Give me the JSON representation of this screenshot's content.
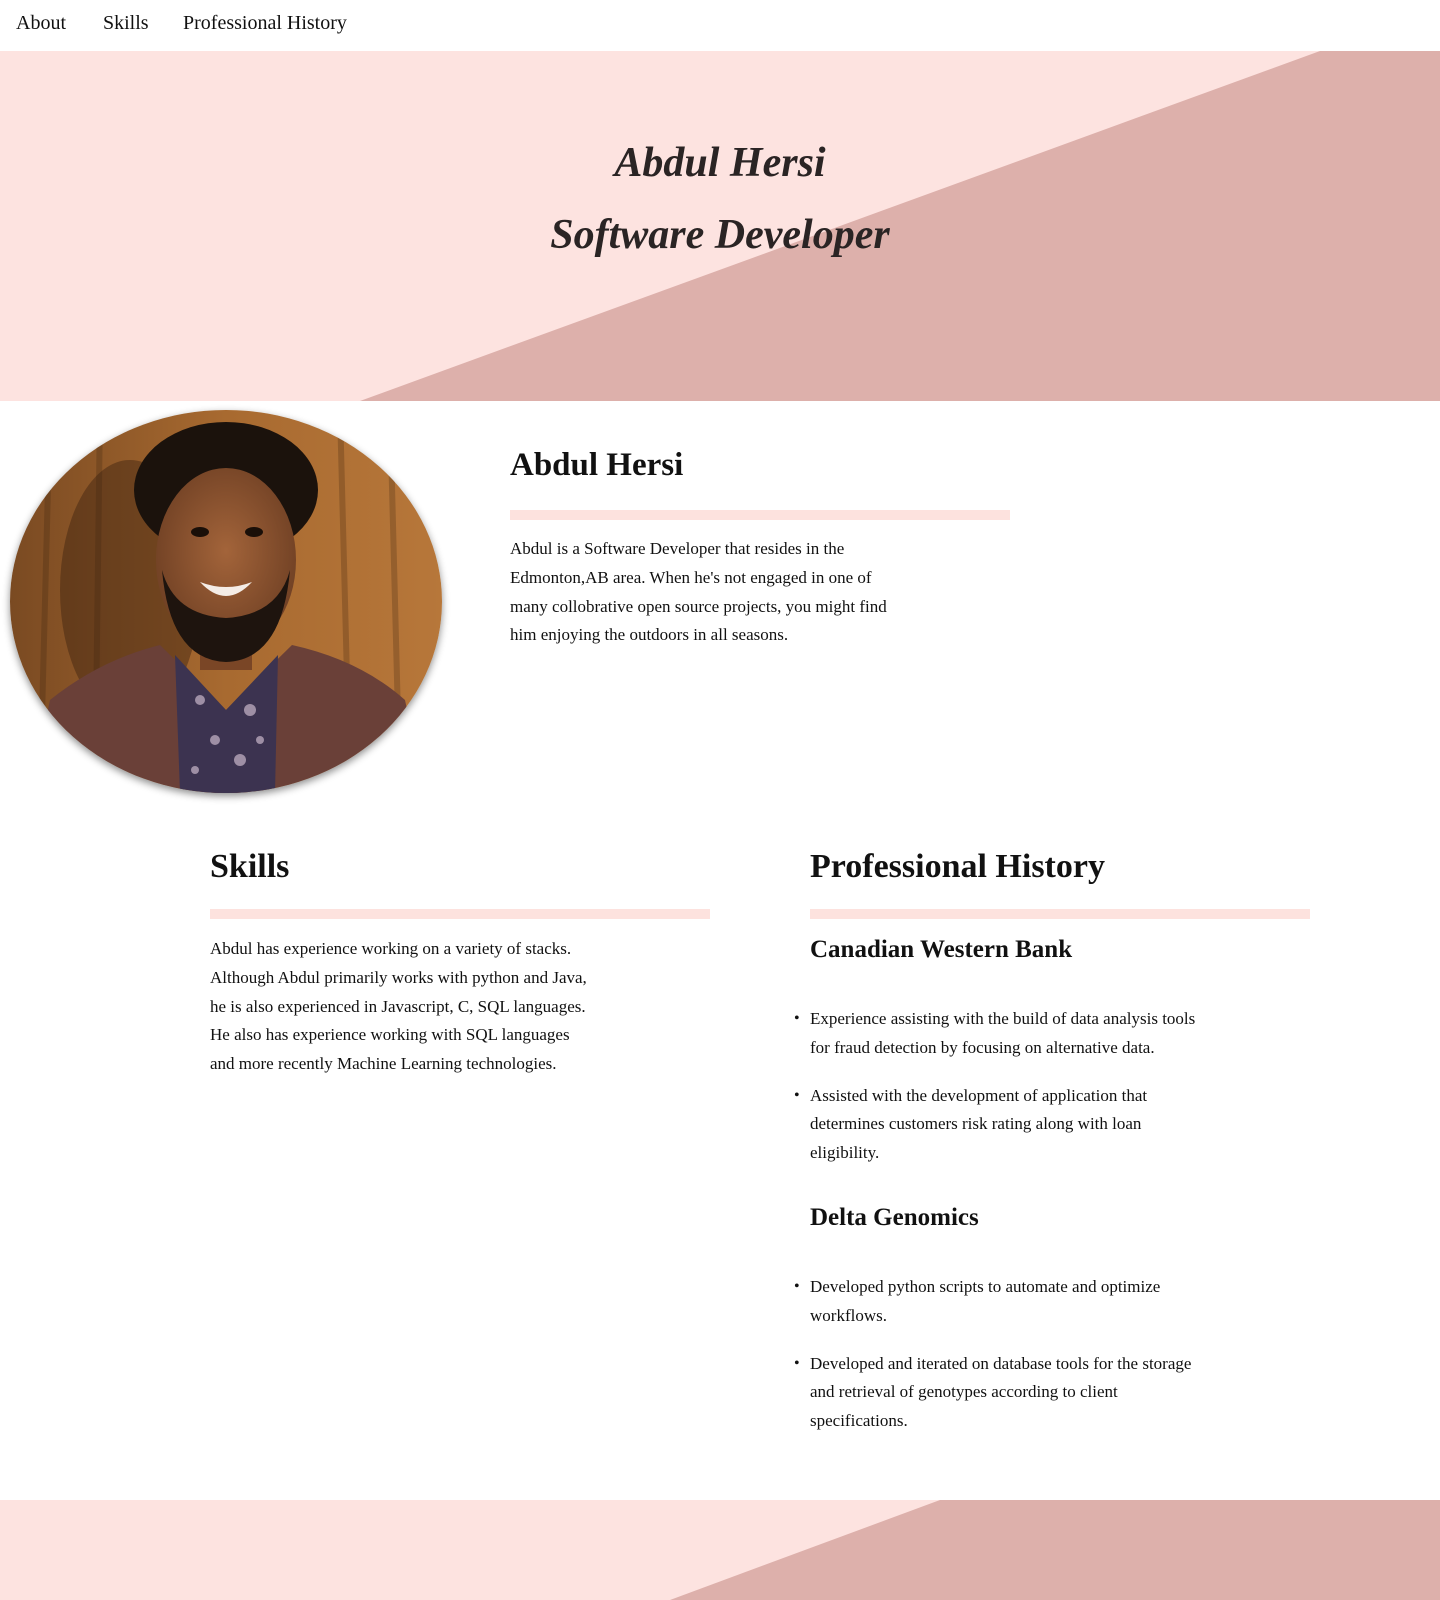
{
  "nav": {
    "items": [
      {
        "label": "About"
      },
      {
        "label": "Skills"
      },
      {
        "label": "Professional History"
      }
    ]
  },
  "hero": {
    "name": "Abdul Hersi",
    "role": "Software Developer",
    "colors": {
      "light": "#fde3e0",
      "dark": "#ddb0ab"
    }
  },
  "about": {
    "name": "Abdul Hersi",
    "lines": [
      "Abdul is a Software Developer that resides in the",
      "Edmonton,AB area. When he's not engaged in one of",
      "many collobrative open source projects, you might find",
      "him enjoying the outdoors in all seasons."
    ]
  },
  "skills": {
    "title": "Skills",
    "lines": [
      "Abdul has experience working on a variety of stacks.",
      "Although Abdul primarily works with python and Java,",
      "he is also experienced in Javascript, C, SQL languages.",
      "He also has experience working with SQL languages",
      "and more recently Machine Learning technologies."
    ]
  },
  "history": {
    "title": "Professional History",
    "jobs": [
      {
        "company": "Canadian Western Bank",
        "bullets": [
          {
            "lines": [
              "Experience assisting with the build of data analysis tools",
              "for fraud detection by focusing on alternative data."
            ]
          },
          {
            "lines": [
              "Assisted with the development of application that",
              "determines customers risk rating along with loan",
              "eligibility."
            ]
          }
        ]
      },
      {
        "company": "Delta Genomics",
        "bullets": [
          {
            "lines": [
              "Developed python scripts to automate and optimize",
              "workflows."
            ]
          },
          {
            "lines": [
              "Developed and iterated on database tools for the storage",
              "and retrieval of genotypes according to client",
              "specifications."
            ]
          }
        ]
      }
    ]
  },
  "colors": {
    "accent_rule": "#fde2de",
    "text": "#111111"
  }
}
